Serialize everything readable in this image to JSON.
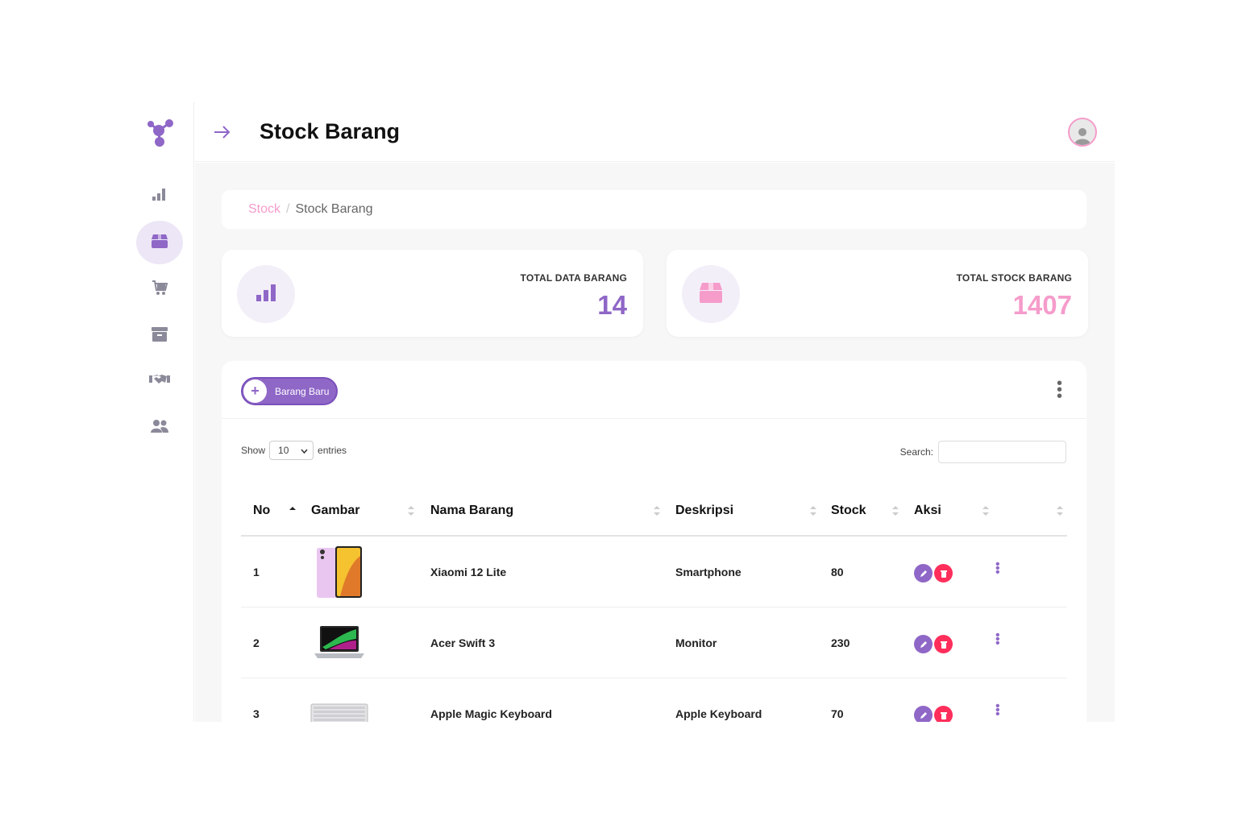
{
  "header": {
    "title": "Stock Barang"
  },
  "sidebar": {
    "items": [
      {
        "icon": "chart-bar-icon"
      },
      {
        "icon": "box-icon"
      },
      {
        "icon": "cart-icon"
      },
      {
        "icon": "archive-icon"
      },
      {
        "icon": "handshake-icon"
      },
      {
        "icon": "users-icon"
      }
    ],
    "active_index": 1
  },
  "breadcrumb": {
    "parent": "Stock",
    "separator": "/",
    "current": "Stock Barang"
  },
  "stats": [
    {
      "label": "TOTAL DATA BARANG",
      "value": "14",
      "icon": "chart-bar-icon",
      "color": "#8f67c7"
    },
    {
      "label": "TOTAL STOCK BARANG",
      "value": "1407",
      "icon": "box-icon",
      "color": "#f59ccb"
    }
  ],
  "table_card": {
    "add_button_label": "Barang Baru",
    "show_label": "Show",
    "entries_value": "10",
    "entries_label": "entries",
    "search_label": "Search:",
    "search_value": "",
    "columns": [
      "No",
      "Gambar",
      "Nama Barang",
      "Deskripsi",
      "Stock",
      "Aksi"
    ],
    "rows": [
      {
        "no": "1",
        "image": "smartphone",
        "name": "Xiaomi 12 Lite",
        "desc": "Smartphone",
        "stock": "80"
      },
      {
        "no": "2",
        "image": "laptop",
        "name": "Acer Swift 3",
        "desc": "Monitor",
        "stock": "230"
      },
      {
        "no": "3",
        "image": "keyboard",
        "name": "Apple Magic Keyboard",
        "desc": "Apple Keyboard",
        "stock": "70"
      }
    ]
  },
  "colors": {
    "accent": "#8f67c7",
    "pink": "#f59ccb",
    "danger": "#ff2e5b",
    "background": "#f7f7f8"
  }
}
